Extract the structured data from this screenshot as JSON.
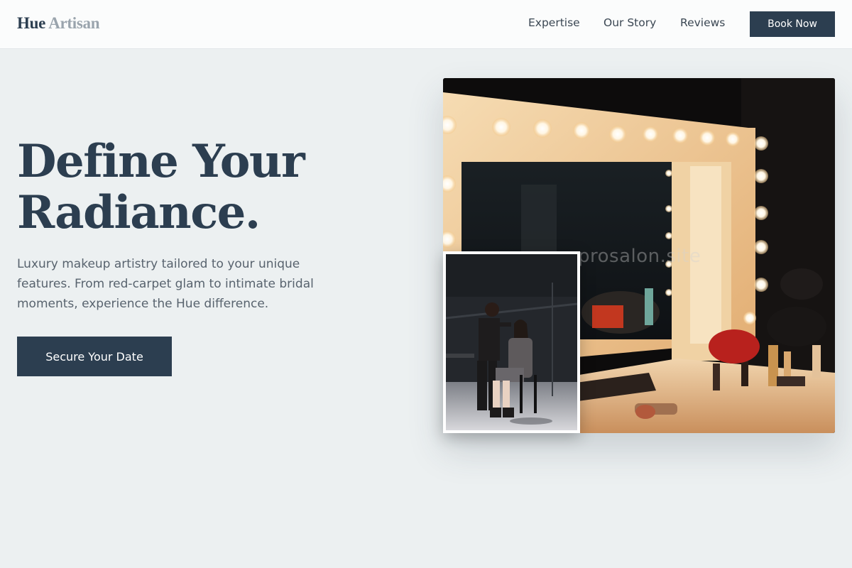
{
  "header": {
    "logo_primary": "Hue",
    "logo_secondary": "Artisan",
    "nav": [
      "Expertise",
      "Our Story",
      "Reviews"
    ],
    "book_label": "Book Now"
  },
  "hero": {
    "headline_line1": "Define Your",
    "headline_line2": "Radiance.",
    "subtext": "Luxury makeup artistry tailored to your unique features. From red-carpet glam to intimate bridal moments, experience the Hue difference.",
    "cta_label": "Secure Your Date",
    "image_watermark": "prosalon.site"
  },
  "colors": {
    "accent": "#2c3e50",
    "background": "#ecf0f1",
    "muted_text": "#58636e",
    "logo_secondary": "#9aa4ad"
  }
}
